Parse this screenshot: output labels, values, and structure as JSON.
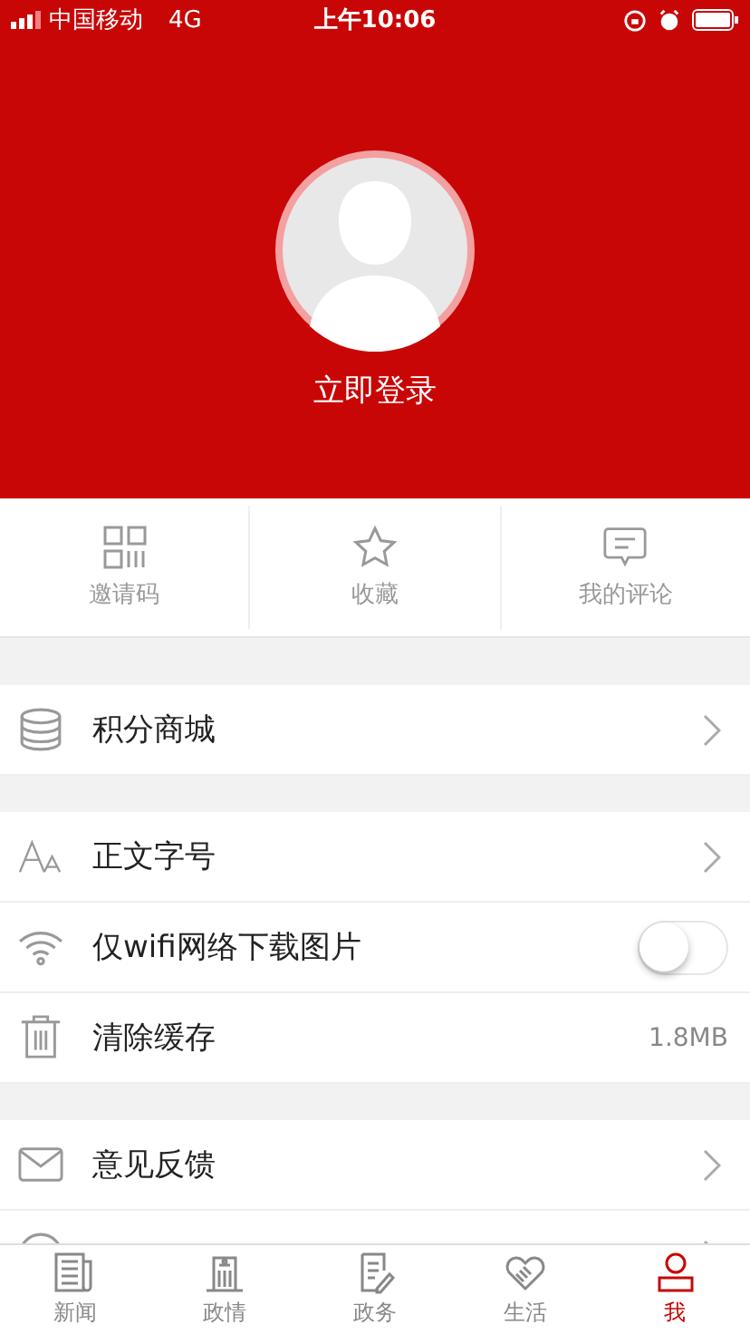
{
  "status_bar": {
    "carrier": "中国移动",
    "network": "4G",
    "time": "上午10:06"
  },
  "profile": {
    "login": "立即登录"
  },
  "shortcuts": [
    {
      "label": "邀请码"
    },
    {
      "label": "收藏"
    },
    {
      "label": "我的评论"
    }
  ],
  "sections": [
    {
      "items": [
        {
          "kind": "link",
          "label": "积分商城"
        }
      ]
    },
    {
      "items": [
        {
          "kind": "link",
          "label": "正文字号"
        },
        {
          "kind": "toggle",
          "label": "仅wifi网络下载图片",
          "on": false
        },
        {
          "kind": "value",
          "label": "清除缓存",
          "value": "1.8MB"
        }
      ]
    },
    {
      "items": [
        {
          "kind": "link",
          "label": "意见反馈"
        },
        {
          "kind": "link"
        }
      ]
    }
  ],
  "tab_bar": [
    {
      "label": "新闻",
      "selected": false
    },
    {
      "label": "政情",
      "selected": false
    },
    {
      "label": "政务",
      "selected": false
    },
    {
      "label": "生活",
      "selected": false
    },
    {
      "label": "我",
      "selected": true
    }
  ]
}
